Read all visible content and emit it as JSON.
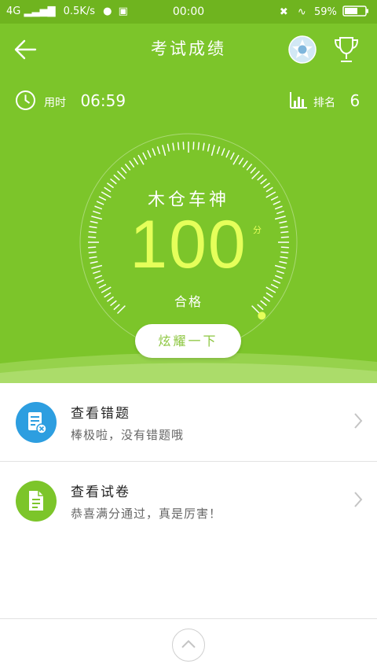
{
  "status_bar": {
    "network": "4G",
    "speed": "0.5K/s",
    "time": "00:00",
    "battery": "59%"
  },
  "header": {
    "back_icon": "arrow-left-icon",
    "title": "考试成绩",
    "badge_icon": "star-badge-icon",
    "trophy_icon": "trophy-icon"
  },
  "stats": {
    "time_label": "用时",
    "time_value": "06:59",
    "rank_label": "排名",
    "rank_value": "6"
  },
  "result": {
    "title": "木仓车神",
    "score": "100",
    "unit": "分",
    "score_fraction": 1.0,
    "status": "合格",
    "show_off_button": "炫耀一下"
  },
  "actions": [
    {
      "title": "查看错题",
      "subtitle": "棒极啦，没有错题哦",
      "icon": "wrong-questions-icon",
      "color": "#2d9ee0"
    },
    {
      "title": "查看试卷",
      "subtitle": "恭喜满分通过，真是厉害！",
      "icon": "exam-paper-icon",
      "color": "#7cc52a"
    }
  ],
  "colors": {
    "primary_green": "#7cc52a",
    "status_green": "#6fb41f",
    "score_yellow": "#e5ff5a",
    "blue": "#2d9ee0"
  },
  "footer": {
    "up_icon": "chevron-up-icon"
  }
}
